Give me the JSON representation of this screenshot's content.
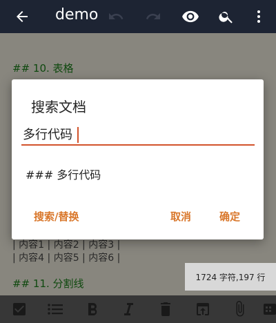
{
  "appbar": {
    "title": "demo",
    "icons": [
      "back-arrow-icon",
      "undo-icon",
      "redo-icon",
      "eye-icon",
      "search-icon",
      "more-vert-icon"
    ]
  },
  "editor": {
    "heading_table": "## 10. 表格",
    "table_row_1": "| 内容1 | 内容2 | 内容3 |",
    "table_row_2": "| 内容4 | 内容5 | 内容6 |",
    "heading_divider": "## 11. 分割线"
  },
  "stats": {
    "text": "1724 字符,197 行"
  },
  "dialog": {
    "title": "搜索文档",
    "input_value": "多行代码",
    "suggestion": "### 多行代码",
    "buttons": {
      "replace": "搜索/替换",
      "cancel": "取消",
      "ok": "确定"
    }
  },
  "colors": {
    "appbar": "#1d2433",
    "accent": "#d9772b",
    "input_underline": "#d2522a",
    "heading": "#1a7a1a"
  }
}
